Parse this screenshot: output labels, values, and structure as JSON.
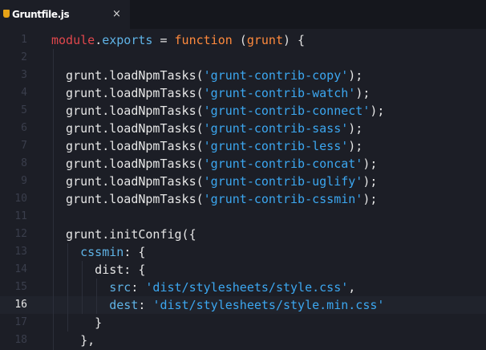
{
  "tab": {
    "icon": "grunt-file-icon",
    "title": "Gruntfile.js",
    "close": "×"
  },
  "editor": {
    "active_line": "16",
    "line_numbers": [
      "1",
      "2",
      "3",
      "4",
      "5",
      "6",
      "7",
      "8",
      "9",
      "10",
      "11",
      "12",
      "13",
      "14",
      "15",
      "16",
      "17",
      "18"
    ],
    "lines": [
      {
        "parts": [
          [
            "kw-module",
            "module"
          ],
          [
            "plain",
            "."
          ],
          [
            "prop",
            "exports"
          ],
          [
            "plain",
            " = "
          ],
          [
            "kw-fn",
            "function"
          ],
          [
            "plain",
            " ("
          ],
          [
            "param",
            "grunt"
          ],
          [
            "plain",
            ") {"
          ]
        ]
      },
      {
        "parts": []
      },
      {
        "parts": [
          [
            "ident",
            "  grunt.loadNpmTasks("
          ],
          [
            "str",
            "'grunt-contrib-copy'"
          ],
          [
            "ident",
            ");"
          ]
        ]
      },
      {
        "parts": [
          [
            "ident",
            "  grunt.loadNpmTasks("
          ],
          [
            "str",
            "'grunt-contrib-watch'"
          ],
          [
            "ident",
            ");"
          ]
        ]
      },
      {
        "parts": [
          [
            "ident",
            "  grunt.loadNpmTasks("
          ],
          [
            "str",
            "'grunt-contrib-connect'"
          ],
          [
            "ident",
            ");"
          ]
        ]
      },
      {
        "parts": [
          [
            "ident",
            "  grunt.loadNpmTasks("
          ],
          [
            "str",
            "'grunt-contrib-sass'"
          ],
          [
            "ident",
            ");"
          ]
        ]
      },
      {
        "parts": [
          [
            "ident",
            "  grunt.loadNpmTasks("
          ],
          [
            "str",
            "'grunt-contrib-less'"
          ],
          [
            "ident",
            ");"
          ]
        ]
      },
      {
        "parts": [
          [
            "ident",
            "  grunt.loadNpmTasks("
          ],
          [
            "str",
            "'grunt-contrib-concat'"
          ],
          [
            "ident",
            ");"
          ]
        ]
      },
      {
        "parts": [
          [
            "ident",
            "  grunt.loadNpmTasks("
          ],
          [
            "str",
            "'grunt-contrib-uglify'"
          ],
          [
            "ident",
            ");"
          ]
        ]
      },
      {
        "parts": [
          [
            "ident",
            "  grunt.loadNpmTasks("
          ],
          [
            "str",
            "'grunt-contrib-cssmin'"
          ],
          [
            "ident",
            ");"
          ]
        ]
      },
      {
        "parts": []
      },
      {
        "parts": [
          [
            "ident",
            "  grunt.initConfig({"
          ]
        ]
      },
      {
        "parts": [
          [
            "key",
            "    cssmin"
          ],
          [
            "ident",
            ": {"
          ]
        ]
      },
      {
        "parts": [
          [
            "ident",
            "      dist: {"
          ]
        ]
      },
      {
        "parts": [
          [
            "key",
            "        src"
          ],
          [
            "ident",
            ": "
          ],
          [
            "str",
            "'dist/stylesheets/style.css'"
          ],
          [
            "ident",
            ","
          ]
        ]
      },
      {
        "parts": [
          [
            "key",
            "        dest"
          ],
          [
            "ident",
            ": "
          ],
          [
            "str",
            "'dist/stylesheets/style.min.css'"
          ]
        ]
      },
      {
        "parts": [
          [
            "ident",
            "      }"
          ]
        ]
      },
      {
        "parts": [
          [
            "ident",
            "    },"
          ]
        ]
      }
    ]
  },
  "colors": {
    "background": "#1c1e26",
    "tabbar": "#15171d",
    "string": "#3ca7f0",
    "keyword_module": "#e0474c",
    "keyword_function": "#ff8a3d",
    "property": "#5fb3e6"
  }
}
